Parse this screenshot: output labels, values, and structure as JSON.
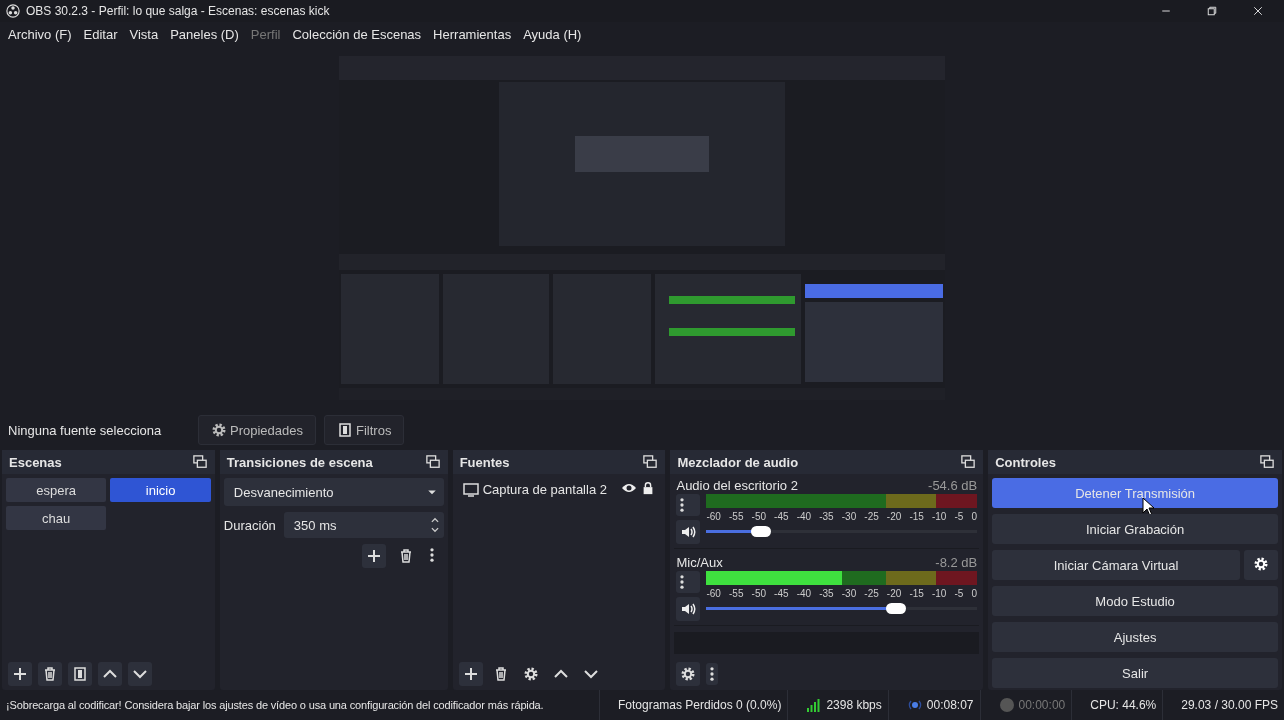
{
  "window": {
    "title": "OBS 30.2.3 - Perfil: lo que salga - Escenas: escenas kick"
  },
  "menu": [
    {
      "label": "Archivo (F)",
      "disabled": false
    },
    {
      "label": "Editar",
      "disabled": false
    },
    {
      "label": "Vista",
      "disabled": false
    },
    {
      "label": "Paneles (D)",
      "disabled": false
    },
    {
      "label": "Perfil",
      "disabled": true
    },
    {
      "label": "Colección de Escenas",
      "disabled": false
    },
    {
      "label": "Herramientas",
      "disabled": false
    },
    {
      "label": "Ayuda (H)",
      "disabled": false
    }
  ],
  "source_toolbar": {
    "status": "Ninguna fuente selecciona",
    "buttons": [
      "Propiedades",
      "Filtros"
    ]
  },
  "scenes": {
    "title": "Escenas",
    "items": [
      {
        "label": "espera",
        "selected": false
      },
      {
        "label": "inicio",
        "selected": true
      },
      {
        "label": "chau",
        "selected": false
      }
    ]
  },
  "transitions": {
    "title": "Transiciones de escena",
    "transition": "Desvanecimiento",
    "duration_label": "Duración",
    "duration": "350 ms"
  },
  "sources": {
    "title": "Fuentes",
    "items": [
      {
        "label": "Captura de pantalla 2",
        "visible": true,
        "locked": true
      }
    ]
  },
  "mixer": {
    "title": "Mezclador de audio",
    "channels": [
      {
        "name": "Audio del escritorio 2",
        "reading": "-54.6 dB",
        "meter": {
          "level": 0
        },
        "volume": {
          "level": 0.2
        },
        "scale": [
          "-60",
          "-55",
          "-50",
          "-45",
          "-40",
          "-35",
          "-30",
          "-25",
          "-20",
          "-15",
          "-10",
          "-5",
          "0"
        ]
      },
      {
        "name": "Mic/Aux",
        "reading": "-8.2 dB",
        "meter": {
          "level": 0.5
        },
        "volume": {
          "level": 0.7
        },
        "scale": [
          "-60",
          "-55",
          "-50",
          "-45",
          "-40",
          "-35",
          "-30",
          "-25",
          "-20",
          "-15",
          "-10",
          "-5",
          "0"
        ]
      }
    ]
  },
  "controls": {
    "title": "Controles",
    "buttons": [
      {
        "label": "Detener Transmisión",
        "active": true,
        "kind": "plain"
      },
      {
        "label": "Iniciar Grabación",
        "active": false,
        "kind": "plain"
      },
      {
        "label": "Iniciar Cámara Virtual",
        "active": false,
        "kind": "with-settings"
      },
      {
        "label": "Modo Estudio",
        "active": false,
        "kind": "plain"
      },
      {
        "label": "Ajustes",
        "active": false,
        "kind": "plain"
      },
      {
        "label": "Salir",
        "active": false,
        "kind": "plain"
      }
    ]
  },
  "status_bar": {
    "message": "¡Sobrecarga al codificar! Considera bajar los ajustes de vídeo o usa una configuración del codificador más rápida.",
    "dropped_frames": "Fotogramas Perdidos 0 (0.0%)",
    "bitrate": "2398 kbps",
    "stream_time": "00:08:07",
    "streaming": true,
    "record_time": "00:00:00",
    "recording": false,
    "cpu": "CPU: 44.6%",
    "fps": "29.03 / 30.00 FPS"
  }
}
